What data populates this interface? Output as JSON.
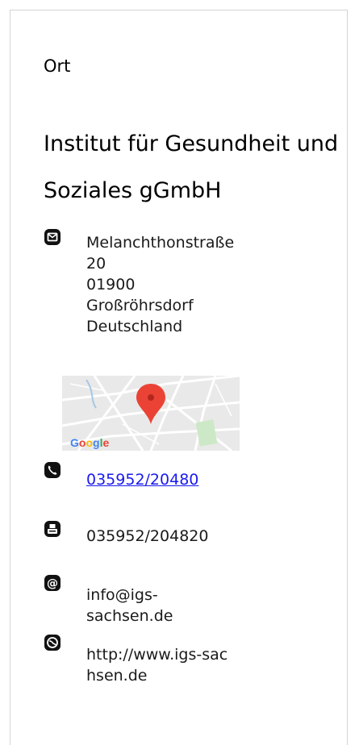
{
  "section_label": "Ort",
  "organization": {
    "line1": "Institut für Gesundheit und",
    "line2": "Soziales gGmbH"
  },
  "address": {
    "icon": "mail-icon",
    "lines": [
      "Melanchthonstraße",
      "20",
      "01900",
      "Großröhrsdorf",
      "Deutschland"
    ]
  },
  "map": {
    "attribution": "Google",
    "marker_color": "#ea4335"
  },
  "phone": {
    "icon": "phone-icon",
    "value": "035952/20480"
  },
  "fax": {
    "icon": "fax-icon",
    "value": "035952/204820"
  },
  "email": {
    "icon": "at-icon",
    "lines": [
      "info@igs-",
      "sachsen.de"
    ]
  },
  "website": {
    "icon": "globe-icon",
    "lines": [
      "http://www.igs-sac",
      "hsen.de"
    ]
  },
  "colors": {
    "link": "#1a1aee",
    "border": "#d4d4d4",
    "text": "#1a1a1a"
  }
}
